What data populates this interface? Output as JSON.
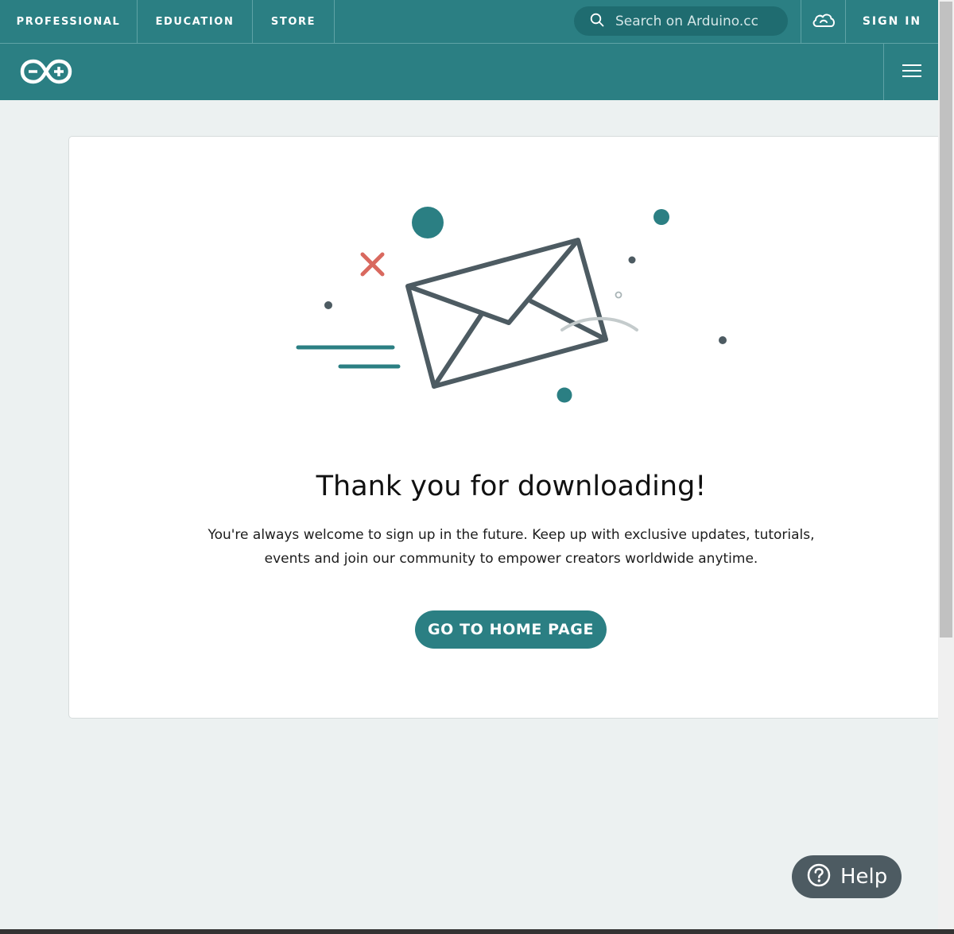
{
  "topnav": {
    "items": [
      "PROFESSIONAL",
      "EDUCATION",
      "STORE"
    ],
    "search_placeholder": "Search on Arduino.cc",
    "signin_label": "SIGN IN"
  },
  "icons": {
    "search": "search-icon",
    "cloud": "cloud-icon",
    "logo": "arduino-logo",
    "menu": "hamburger-menu-icon",
    "help": "question-mark-icon"
  },
  "content": {
    "title": "Thank you for downloading!",
    "subtitle_line1": "You're always welcome to sign up in the future. Keep up with exclusive updates, tutorials,",
    "subtitle_line2": "events and join our community to empower creators worldwide anytime.",
    "home_button": "GO TO HOME PAGE"
  },
  "help": {
    "label": "Help"
  },
  "colors": {
    "brand_teal": "#2b7f83",
    "search_bg": "#1f6c70",
    "page_bg": "#ecf1f1",
    "envelope": "#4d5b62",
    "accent_red": "#d9695f",
    "help_bg": "#4d5b62"
  }
}
